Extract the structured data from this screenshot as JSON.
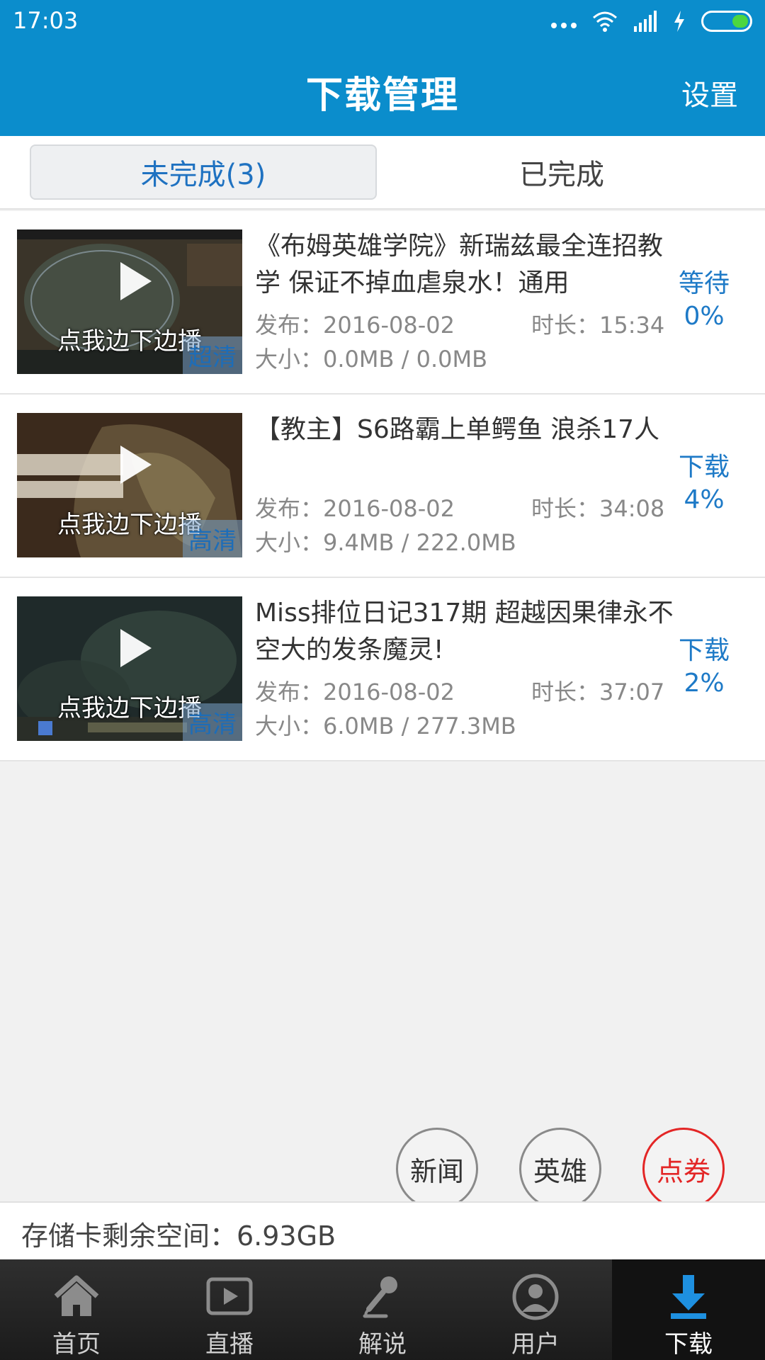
{
  "status_bar": {
    "time": "17:03"
  },
  "header": {
    "title": "下载管理",
    "settings_label": "设置"
  },
  "tabs": [
    {
      "label": "未完成(3)",
      "active": true
    },
    {
      "label": "已完成",
      "active": false
    }
  ],
  "items": [
    {
      "title": "《布姆英雄学院》新瑞兹最全连招教学 保证不掉血虐泉水！通用",
      "thumb_caption": "点我边下边播",
      "quality": "超清",
      "publish": "发布：2016-08-02",
      "duration": "时长：15:34",
      "size": "大小：0.0MB / 0.0MB",
      "status": "等待",
      "percent": "0%"
    },
    {
      "title": "【教主】S6路霸上单鳄鱼 浪杀17人",
      "thumb_caption": "点我边下边播",
      "quality": "高清",
      "publish": "发布：2016-08-02",
      "duration": "时长：34:08",
      "size": "大小：9.4MB / 222.0MB",
      "status": "下载",
      "percent": "4%"
    },
    {
      "title": "Miss排位日记317期 超越因果律永不空大的发条魔灵!",
      "thumb_caption": "点我边下边播",
      "quality": "高清",
      "publish": "发布：2016-08-02",
      "duration": "时长：37:07",
      "size": "大小：6.0MB / 277.3MB",
      "status": "下载",
      "percent": "2%"
    }
  ],
  "floating_buttons": [
    {
      "label": "新闻"
    },
    {
      "label": "英雄"
    },
    {
      "label": "点券"
    }
  ],
  "storage": {
    "text": "存储卡剩余空间：6.93GB"
  },
  "bottom_nav": [
    {
      "label": "首页",
      "icon": "home-icon"
    },
    {
      "label": "直播",
      "icon": "live-play-icon"
    },
    {
      "label": "解说",
      "icon": "microphone-icon"
    },
    {
      "label": "用户",
      "icon": "user-icon"
    },
    {
      "label": "下载",
      "icon": "download-icon",
      "active": true
    }
  ],
  "colors": {
    "header": "#0b8dcc",
    "accent": "#1e7ac7",
    "red": "#e32626"
  }
}
